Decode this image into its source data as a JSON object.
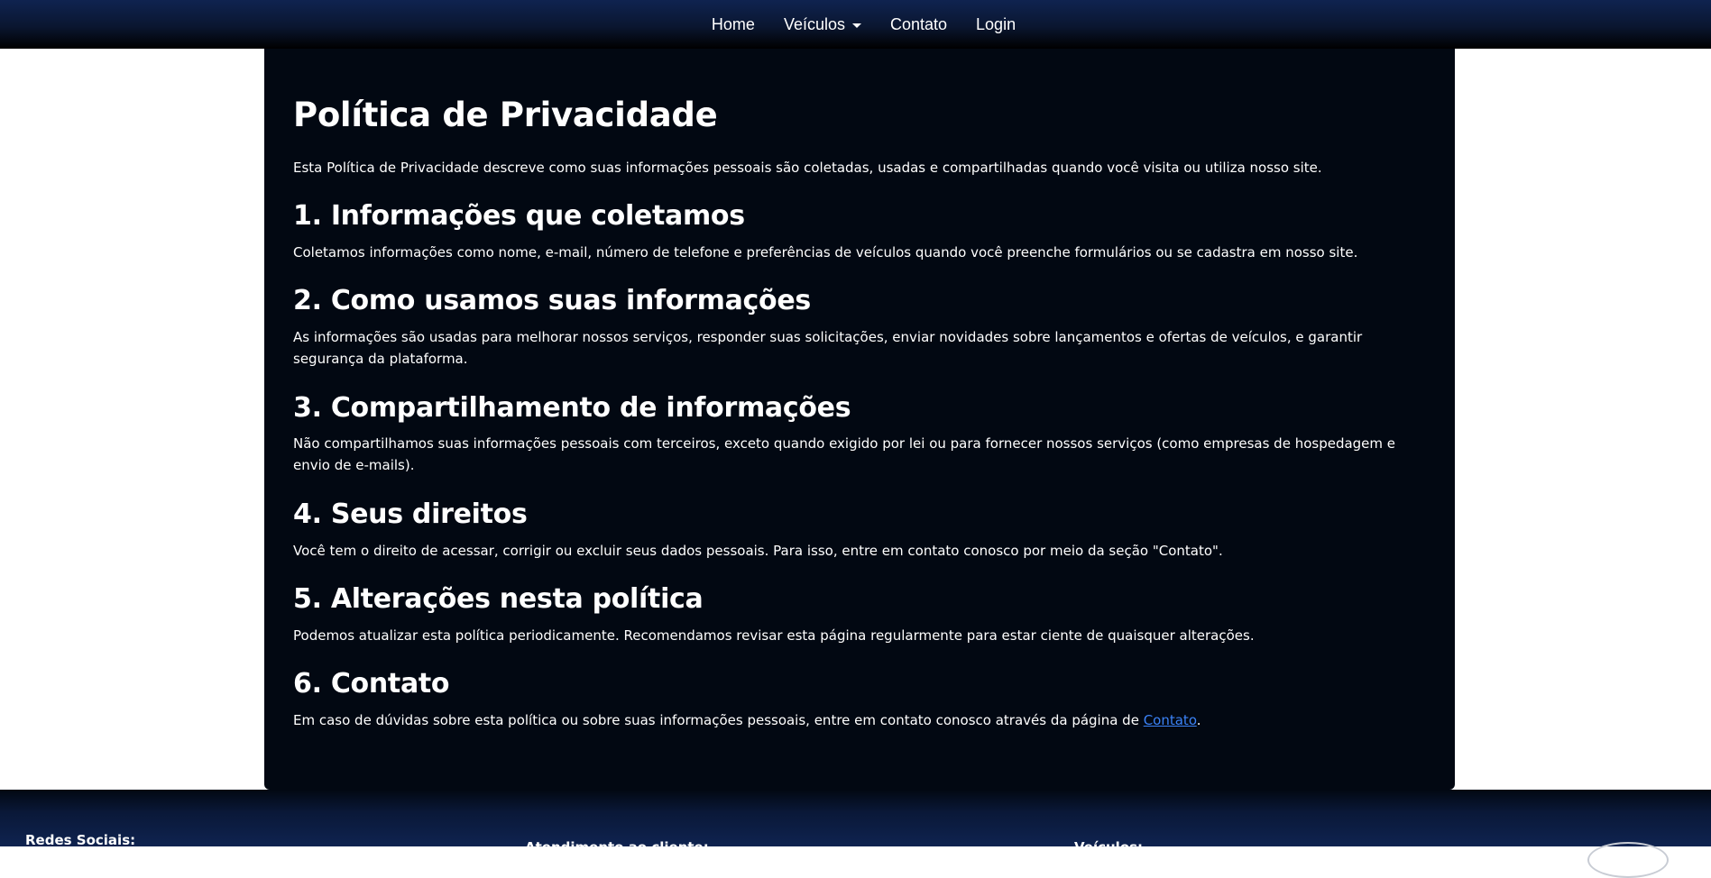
{
  "nav": {
    "home": "Home",
    "veiculos": "Veículos",
    "contato": "Contato",
    "login": "Login"
  },
  "main": {
    "title": "Política de Privacidade",
    "intro": "Esta Política de Privacidade descreve como suas informações pessoais são coletadas, usadas e compartilhadas quando você visita ou utiliza nosso site.",
    "sections": [
      {
        "heading": "1. Informações que coletamos",
        "text": "Coletamos informações como nome, e-mail, número de telefone e preferências de veículos quando você preenche formulários ou se cadastra em nosso site."
      },
      {
        "heading": "2. Como usamos suas informações",
        "text": "As informações são usadas para melhorar nossos serviços, responder suas solicitações, enviar novidades sobre lançamentos e ofertas de veículos, e garantir segurança da plataforma."
      },
      {
        "heading": "3. Compartilhamento de informações",
        "text": "Não compartilhamos suas informações pessoais com terceiros, exceto quando exigido por lei ou para fornecer nossos serviços (como empresas de hospedagem e envio de e-mails)."
      },
      {
        "heading": "4. Seus direitos",
        "text": "Você tem o direito de acessar, corrigir ou excluir seus dados pessoais. Para isso, entre em contato conosco por meio da seção \"Contato\"."
      },
      {
        "heading": "5. Alterações nesta política",
        "text": "Podemos atualizar esta política periodicamente. Recomendamos revisar esta página regularmente para estar ciente de quaisquer alterações."
      },
      {
        "heading": "6. Contato",
        "text_before": "Em caso de dúvidas sobre esta política ou sobre suas informações pessoais, entre em contato conosco através da página de ",
        "link_label": "Contato",
        "text_after": "."
      }
    ]
  },
  "footer": {
    "social_title": "Redes Sociais:",
    "support_title": "Atendimento ao cliente:",
    "vehicles_title": "Veículos:"
  },
  "colors": {
    "card_background": "#020812",
    "nav_top": "#0f2350",
    "link": "#3b82f6"
  }
}
